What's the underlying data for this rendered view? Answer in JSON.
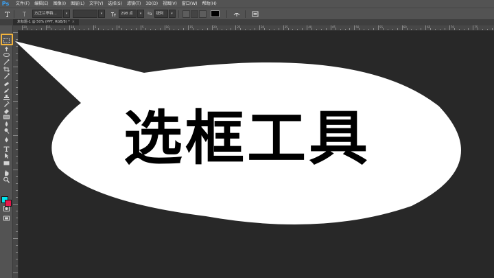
{
  "app": {
    "logo": "Ps"
  },
  "menu": [
    "文件(F)",
    "编辑(E)",
    "图像(I)",
    "图层(L)",
    "文字(Y)",
    "选择(S)",
    "滤镜(T)",
    "3D(D)",
    "视图(V)",
    "窗口(W)",
    "帮助(H)"
  ],
  "options": {
    "font_family": "方正兰亭特...",
    "font_size": "298 点",
    "antialias": "锐利",
    "aa_label": "ªa",
    "text_color": "#000000"
  },
  "document": {
    "tab_title": "未标题-1 @ 50% (PPT, RGB/8) *",
    "close": "×"
  },
  "ruler": {
    "top_labels": [
      "20",
      "15",
      "10",
      "5",
      "0",
      "5",
      "10",
      "15",
      "20",
      "25",
      "30",
      "35",
      "40",
      "45",
      "50",
      "55",
      "60",
      "65",
      "70",
      "75"
    ]
  },
  "tools": [
    "marquee-icon",
    "move-icon",
    "lasso-icon",
    "magic-wand-icon",
    "crop-icon",
    "eyedropper-icon",
    "healing-icon",
    "brush-icon",
    "stamp-icon",
    "history-brush-icon",
    "eraser-icon",
    "gradient-icon",
    "blur-icon",
    "dodge-icon",
    "pen-icon",
    "type-icon",
    "path-select-icon",
    "rectangle-icon",
    "hand-icon",
    "zoom-icon"
  ],
  "swatches": {
    "foreground": "#00e5ee",
    "background": "#e8164c"
  },
  "callout": {
    "text": "选框工具"
  },
  "colors": {
    "highlight": "#f2b33d",
    "workspace": "#282828"
  }
}
